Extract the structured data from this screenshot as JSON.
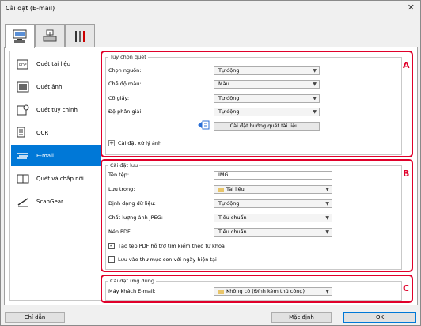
{
  "window": {
    "title": "Cài đặt (E-mail)",
    "close": "✕"
  },
  "tabs": [
    {
      "name": "scan-from-computer"
    },
    {
      "name": "scan-from-operation-panel"
    },
    {
      "name": "general-settings"
    }
  ],
  "sidebar": {
    "items": [
      {
        "label": "Quét tài liệu"
      },
      {
        "label": "Quét ảnh"
      },
      {
        "label": "Quét tùy chỉnh"
      },
      {
        "label": "OCR"
      },
      {
        "label": "E-mail"
      },
      {
        "label": "Quét và chắp nối"
      },
      {
        "label": "ScanGear"
      }
    ]
  },
  "scan_options": {
    "group_title": "Tùy chọn quét",
    "marker": "A",
    "source_label": "Chọn nguồn:",
    "source_value": "Tự động",
    "color_label": "Chế độ màu:",
    "color_value": "Màu",
    "paper_label": "Cỡ giấy:",
    "paper_value": "Tự động",
    "resolution_label": "Độ phân giải:",
    "resolution_value": "Tự động",
    "doc_settings_button": "Cài đặt hướng quét tài liệu...",
    "image_processing_label": "Cài đặt xử lý ảnh",
    "expand": "+"
  },
  "save_settings": {
    "group_title": "Cài đặt lưu",
    "marker": "B",
    "filename_label": "Tên tệp:",
    "filename_value": "IMG",
    "save_in_label": "Lưu trong:",
    "save_in_value": "Tài liệu",
    "format_label": "Định dạng dữ liệu:",
    "format_value": "Tự động",
    "jpeg_label": "Chất lượng ảnh JPEG:",
    "jpeg_value": "Tiêu chuẩn",
    "pdf_label": "Nén PDF:",
    "pdf_value": "Tiêu chuẩn",
    "keyword_pdf_label": "Tạo tệp PDF hỗ trợ tìm kiếm theo từ khóa",
    "keyword_pdf_checked": "✓",
    "subfolder_label": "Lưu vào thư mục con với ngày hiện tại"
  },
  "app_settings": {
    "group_title": "Cài đặt ứng dụng",
    "marker": "C",
    "email_label": "Máy khách E-mail:",
    "email_value": "Không có (Đính kèm thủ công)"
  },
  "footer": {
    "instructions": "Chỉ dẫn",
    "defaults": "Mặc định",
    "ok": "OK"
  },
  "colors": {
    "selected": "#0078d7",
    "marker": "#e0002a"
  }
}
